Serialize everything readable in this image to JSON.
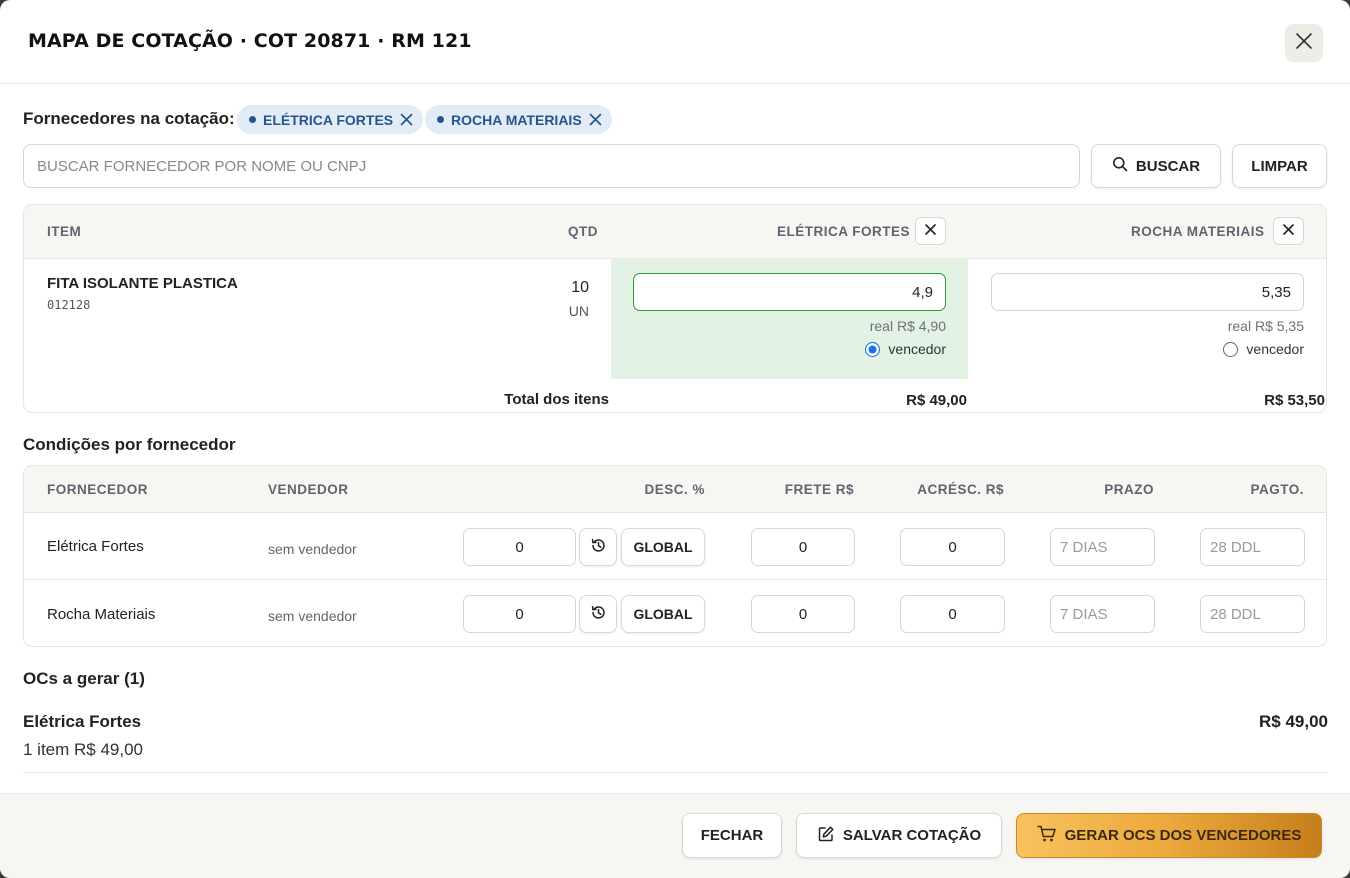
{
  "modal": {
    "title": "MAPA DE COTAÇÃO · COT 20871 · RM 121",
    "close_icon": "close-icon"
  },
  "suppliers_bar": {
    "label": "Fornecedores na cotação:",
    "chips": [
      {
        "label": "ELÉTRICA FORTES",
        "remove_icon": "close-icon"
      },
      {
        "label": "ROCHA MATERIAIS",
        "remove_icon": "close-icon"
      }
    ]
  },
  "search": {
    "placeholder": "BUSCAR FORNECEDOR POR NOME OU CNPJ",
    "value": "",
    "search_button": "BUSCAR",
    "search_icon": "search-icon",
    "clear_button": "LIMPAR"
  },
  "items_table": {
    "headers": {
      "item": "ITEM",
      "qty": "QTD",
      "supplier1": "ELÉTRICA FORTES",
      "supplier2": "ROCHA MATERIAIS"
    },
    "rows": [
      {
        "name": "FITA ISOLANTE PLASTICA",
        "code": "012128",
        "qty": "10",
        "unit": "UN",
        "prices": [
          {
            "value": "4,9",
            "real": "real R$ 4,90",
            "winner_label": "vencedor",
            "selected": true
          },
          {
            "value": "5,35",
            "real": "real R$ 5,35",
            "winner_label": "vencedor",
            "selected": false
          }
        ]
      }
    ],
    "totals": {
      "label": "Total dos itens",
      "supplier1": "R$ 49,00",
      "supplier2": "R$ 53,50"
    },
    "colors": {
      "winner_bg": "#e2f2e4",
      "winner_border": "#2e9a3e"
    }
  },
  "conditions": {
    "title": "Condições por fornecedor",
    "headers": {
      "supplier": "FORNECEDOR",
      "seller": "VENDEDOR",
      "discount": "DESC. %",
      "freight": "FRETE R$",
      "surcharge": "ACRÉSC. R$",
      "term": "PRAZO",
      "payment": "PAGTO."
    },
    "rows": [
      {
        "supplier": "Elétrica Fortes",
        "seller": "sem vendedor",
        "discount": "0",
        "global_button": "GLOBAL",
        "history_icon": "history-icon",
        "freight": "0",
        "surcharge": "0",
        "term_placeholder": "7 DIAS",
        "payment_placeholder": "28 DDL"
      },
      {
        "supplier": "Rocha Materiais",
        "seller": "sem vendedor",
        "discount": "0",
        "global_button": "GLOBAL",
        "history_icon": "history-icon",
        "freight": "0",
        "surcharge": "0",
        "term_placeholder": "7 DIAS",
        "payment_placeholder": "28 DDL"
      }
    ]
  },
  "orders": {
    "title": "OCs a gerar (1)",
    "list": [
      {
        "supplier": "Elétrica Fortes",
        "summary": "1 item R$ 49,00",
        "total": "R$ 49,00"
      }
    ]
  },
  "footer": {
    "close_button": "FECHAR",
    "save_button": "SALVAR COTAÇÃO",
    "save_icon": "edit-icon",
    "generate_button": "GERAR OCS DOS VENCEDORES",
    "generate_icon": "cart-icon"
  }
}
